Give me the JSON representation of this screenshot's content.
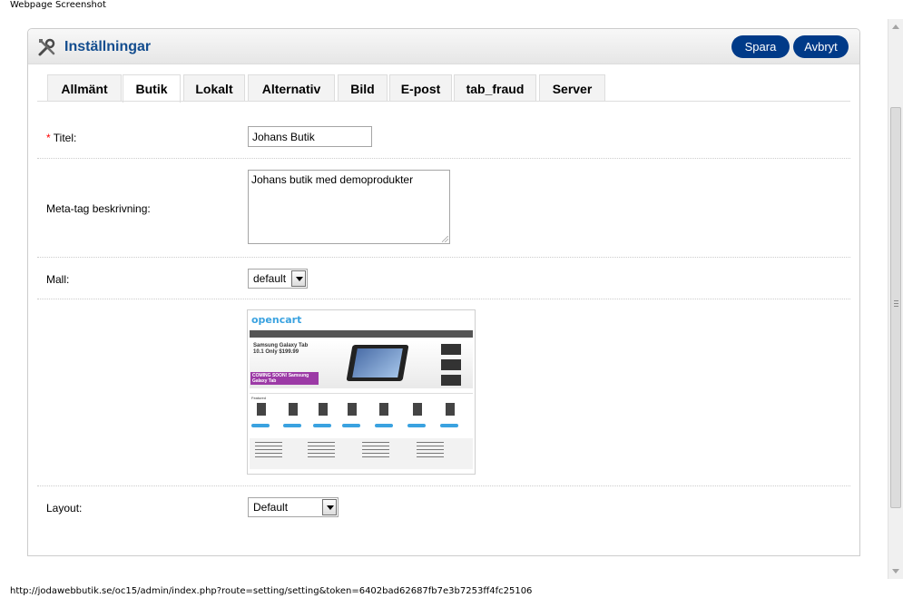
{
  "caption": "Webpage Screenshot",
  "header": {
    "title": "Inställningar",
    "save_label": "Spara",
    "cancel_label": "Avbryt"
  },
  "tabs": [
    {
      "label": "Allmänt",
      "active": false
    },
    {
      "label": "Butik",
      "active": true
    },
    {
      "label": "Lokalt",
      "active": false
    },
    {
      "label": "Alternativ",
      "active": false
    },
    {
      "label": "Bild",
      "active": false
    },
    {
      "label": "E-post",
      "active": false
    },
    {
      "label": "tab_fraud",
      "active": false
    },
    {
      "label": "Server",
      "active": false
    }
  ],
  "form": {
    "title": {
      "required_mark": "*",
      "label": "Titel:",
      "value": "Johans Butik"
    },
    "meta": {
      "label": "Meta-tag beskrivning:",
      "value": "Johans butik med demoprodukter"
    },
    "template": {
      "label": "Mall:",
      "value": "default"
    },
    "layout": {
      "label": "Layout:",
      "value": "Default"
    }
  },
  "preview": {
    "logo": "opencart",
    "banner": "Samsung Galaxy Tab 10.1 Only $199.99",
    "promo": "COMING SOON! Samsung Galaxy Tab",
    "featured": "Featured"
  },
  "status_url": "http://jodawebbutik.se/oc15/admin/index.php?route=setting/setting&token=6402bad62687fb7e3b7253ff4fc25106",
  "colors": {
    "accent": "#134d8f",
    "button": "#003a88",
    "required": "#ff0000"
  }
}
